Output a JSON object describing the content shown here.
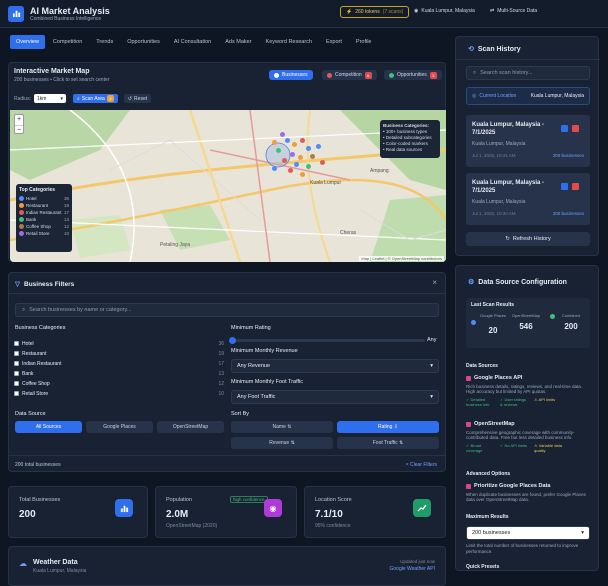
{
  "header": {
    "title": "AI Market Analysis",
    "subtitle": "Combined Business Intelligence",
    "tokens": "260 tokens",
    "tokens_scans": "(7 scans)",
    "location": "Kuala Lumpur, Malaysia",
    "source_mode": "Multi-Source Data"
  },
  "tabs": [
    "Overview",
    "Competition",
    "Trends",
    "Opportunities",
    "AI Consultation",
    "Ads Maker",
    "Keyword Research",
    "Export",
    "Profile"
  ],
  "map_panel": {
    "title": "Interactive Market Map",
    "subtitle": "200 businesses • Click to set search center",
    "chips": {
      "businesses": "Businesses",
      "competition": "Competition",
      "competition_count": "6",
      "opportunities": "Opportunities",
      "opportunities_count": "3"
    },
    "radius_label": "Radius:",
    "radius_value": "1km",
    "scan_label": "Scan Area",
    "scan_count": "3",
    "reset_label": "Reset",
    "legend_title": "Business Categories:",
    "legend_lines": [
      "• 100+ business types",
      "• Detailed subcategories",
      "• Color-coded markers",
      "• Real data sources"
    ],
    "top_categories_title": "Top Categories",
    "top_categories": [
      {
        "name": "Hotel",
        "count": "36",
        "color": "#4e8cff"
      },
      {
        "name": "Restaurant",
        "count": "19",
        "color": "#f29c38"
      },
      {
        "name": "Indian Restaurant",
        "count": "17",
        "color": "#e25a5a"
      },
      {
        "name": "Bank",
        "count": "13",
        "color": "#3fbf7f"
      },
      {
        "name": "Coffee Shop",
        "count": "12",
        "color": "#b07a4a"
      },
      {
        "name": "Retail Store",
        "count": "10",
        "color": "#9a6ee8"
      }
    ],
    "places": [
      "Petaling Jaya",
      "Kuala Lumpur",
      "Cheras",
      "Ampang"
    ],
    "attribution": "Map  |  Leaflet  |  © OpenStreetMap contributors"
  },
  "filters": {
    "title": "Business Filters",
    "search_placeholder": "Search businesses by name or category...",
    "categories_label": "Business Categories",
    "categories": [
      {
        "name": "Hotel",
        "count": "36"
      },
      {
        "name": "Restaurant",
        "count": "19"
      },
      {
        "name": "Indian Restaurant",
        "count": "17"
      },
      {
        "name": "Bank",
        "count": "13"
      },
      {
        "name": "Coffee Shop",
        "count": "12"
      },
      {
        "name": "Retail Store",
        "count": "10"
      }
    ],
    "min_rating_label": "Minimum Rating",
    "min_rating_value": "Any",
    "revenue_label": "Minimum Monthly Revenue",
    "revenue_value": "Any Revenue",
    "traffic_label": "Minimum Monthly Foot Traffic",
    "traffic_value": "Any Foot Traffic",
    "data_source_label": "Data Source",
    "data_sources": [
      "All Sources",
      "Google Places",
      "OpenStreetMap"
    ],
    "sort_label": "Sort By",
    "sort_options": [
      "Name ⇅",
      "Rating ⇩",
      "Revenue ⇅",
      "Foot Traffic ⇅"
    ],
    "total": "200 total businesses",
    "clear": "× Clear Filters"
  },
  "stats": [
    {
      "label": "Total Businesses",
      "value": "200",
      "sub": "",
      "badge": "",
      "icon": "bar-chart-icon",
      "color": "#2f6fed"
    },
    {
      "label": "Population",
      "value": "2.0M",
      "sub": "OpenStreetMap (2020)",
      "badge": "high confidence",
      "icon": "location-pin-icon",
      "color": "#b03ad9"
    },
    {
      "label": "Location Score",
      "value": "7.1/10",
      "sub": "95% confidence",
      "badge": "",
      "icon": "trend-up-icon",
      "color": "#1f9d68"
    }
  ],
  "weather": {
    "title": "Weather Data",
    "sub": "Kuala Lumpur, Malaysia",
    "right1": "Updated just now",
    "right2": "Google Weather API"
  },
  "scan_history": {
    "title": "Scan History",
    "search_placeholder": "Search scan history...",
    "current_label": "Current Location",
    "current_value": "Kuala Lumpur, Malaysia",
    "items": [
      {
        "title": "Kuala Lumpur, Malaysia - 7/1/2025",
        "location": "Kuala Lumpur, Malaysia",
        "date": "Jul 1, 2025, 10:41 AM",
        "count": "200 businesses"
      },
      {
        "title": "Kuala Lumpur, Malaysia - 7/1/2025",
        "location": "Kuala Lumpur, Malaysia",
        "date": "Jul 1, 2025, 10:30 AM",
        "count": "200 businesses"
      }
    ],
    "refresh": "Refresh History"
  },
  "data_source_config": {
    "title": "Data Source Configuration",
    "last_scan_title": "Last Scan Results",
    "google_label": "Google Places",
    "google_value": "20",
    "osm_label": "OpenStreetMap",
    "osm_value": "546",
    "combined_label": "Combined",
    "combined_value": "200",
    "sources_label": "Data Sources",
    "google_api": {
      "title": "Google Places API",
      "desc": "Rich business details, ratings, reviews, and real-time data. High accuracy but limited by API quotas.",
      "tags": [
        "✓ Detailed business info",
        "✓ User ratings & reviews",
        "⚠ API limits"
      ]
    },
    "osm": {
      "title": "OpenStreetMap",
      "desc": "Comprehensive geographic coverage with community-contributed data. Free but less detailed business info.",
      "tags": [
        "✓ Broad coverage",
        "✓ No API limits",
        "⚠ Variable data quality"
      ]
    },
    "advanced_label": "Advanced Options",
    "prioritize_title": "Prioritize Google Places Data",
    "prioritize_desc": "When duplicate businesses are found, prefer Google Places data over OpenStreetMap data.",
    "max_label": "Maximum Results",
    "max_value": "200 businesses",
    "max_desc": "Limit the total number of businesses returned to improve performance.",
    "quick_presets": "Quick Presets"
  }
}
